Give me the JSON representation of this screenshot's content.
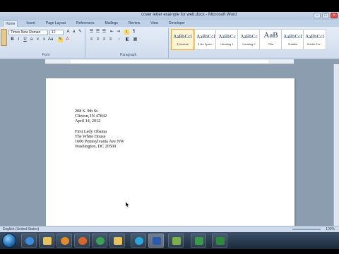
{
  "window": {
    "title": "cover letter example for web.docx - Microsoft Word",
    "controls": [
      "–",
      "□",
      "×"
    ]
  },
  "ribbon": {
    "tabs": [
      "Home",
      "Insert",
      "Page Layout",
      "References",
      "Mailings",
      "Review",
      "View",
      "Developer"
    ],
    "active_tab": "Home",
    "font_name": "Times New Roman",
    "font_size": "12",
    "groups": {
      "font": "Font",
      "paragraph": "Paragraph"
    },
    "styles": [
      {
        "sample": "AaBbCcI",
        "name": "¶ Normal"
      },
      {
        "sample": "AaBbCcI",
        "name": "¶ No Spaci..."
      },
      {
        "sample": "AaBbCc",
        "name": "Heading 1"
      },
      {
        "sample": "AaBbCc",
        "name": "Heading 2"
      },
      {
        "sample": "AaB",
        "name": "Title"
      },
      {
        "sample": "AaBbCcI",
        "name": "Subtitle"
      },
      {
        "sample": "AaBbCcI",
        "name": "Subtle Em..."
      }
    ]
  },
  "document": {
    "sender": [
      "208 S. 9th St.",
      "Clinton, IN 47842",
      "April 14, 2012"
    ],
    "recipient": [
      "First Lady Obama",
      "The White House",
      "1600 Pennsylvania Ave NW",
      "Washington, DC 20500"
    ]
  },
  "statusbar": {
    "status": "English (United States)",
    "zoom": "100%"
  },
  "colors": {
    "accent": "#e4a83a",
    "ribbon": "#d0dcec",
    "doc_background": "#8d9db0"
  },
  "taskbar_icons": [
    "ie-icon",
    "folder-icon",
    "media-player-icon",
    "firefox-icon",
    "chrome-icon",
    "folder-icon",
    "skype-icon",
    "word-icon",
    "photos-icon",
    "camtasia-icon",
    "excel-icon"
  ]
}
